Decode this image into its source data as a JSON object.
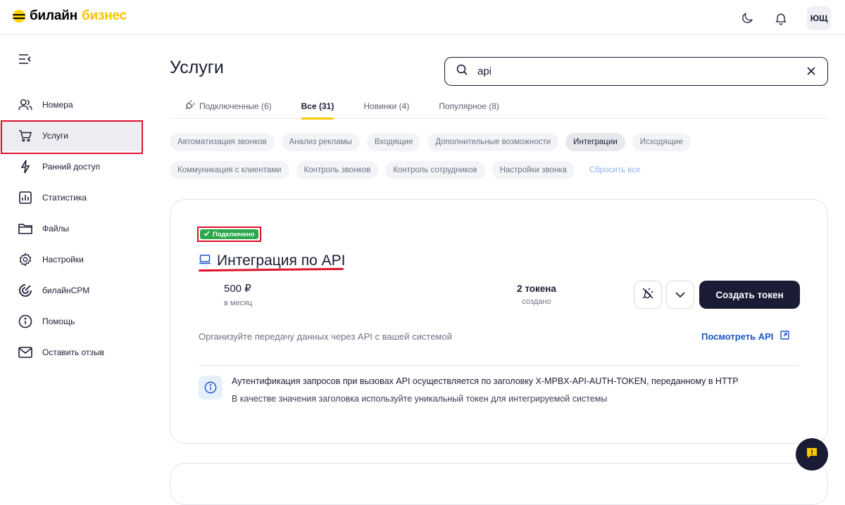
{
  "brand": {
    "name_part1": "билайн",
    "name_part2": "бизнес",
    "accent": "#ffc800"
  },
  "header": {
    "avatar_initials": "ЮЩ",
    "icons": [
      "moon-icon",
      "bell-icon"
    ]
  },
  "sidebar": {
    "items": [
      {
        "label": "Номера",
        "icon": "people-icon"
      },
      {
        "label": "Услуги",
        "icon": "cart-icon",
        "active": true
      },
      {
        "label": "Ранний доступ",
        "icon": "lightning-icon"
      },
      {
        "label": "Статистика",
        "icon": "chart-icon"
      },
      {
        "label": "Файлы",
        "icon": "folder-icon"
      },
      {
        "label": "Настройки",
        "icon": "gear-icon"
      },
      {
        "label": "билайнCPM",
        "icon": "crm-icon"
      },
      {
        "label": "Помощь",
        "icon": "info-icon"
      },
      {
        "label": "Оставить отзыв",
        "icon": "mail-icon"
      }
    ]
  },
  "page": {
    "title": "Услуги"
  },
  "search": {
    "value": "api"
  },
  "tabs": [
    {
      "label": "Подключенные (6)"
    },
    {
      "label": "Все (31)",
      "active": true
    },
    {
      "label": "Новинки (4)"
    },
    {
      "label": "Популярное (8)"
    }
  ],
  "filters": {
    "row1": [
      "Автоматизация звонков",
      "Анализ рекламы",
      "Входящие",
      "Дополнительные возможности",
      "Интеграции",
      "Исходящие"
    ],
    "row2": [
      "Коммуникация с клиентами",
      "Контроль звонков",
      "Контроль сотрудников",
      "Настройки звонка"
    ],
    "active": "Интеграции",
    "reset_label": "Сбросить все"
  },
  "service": {
    "status": "Подключено",
    "status_color": "#2aa84a",
    "title": "Интеграция по API",
    "price": "500 ₽",
    "price_period": "в месяц",
    "tokens_value": "2 токена",
    "tokens_label": "создано",
    "create_button": "Создать токен",
    "description": "Организуйте передачу данных через API с вашей системой",
    "api_link": "Посмотреть API",
    "info_line1": "Аутентификация запросов при вызовах API осуществляется по заголовку X-MPBX-API-AUTH-TOKEN, переданному в HTTP",
    "info_line2": "В качестве значения заголовка используйте уникальный токен для интегрируемой системы"
  }
}
